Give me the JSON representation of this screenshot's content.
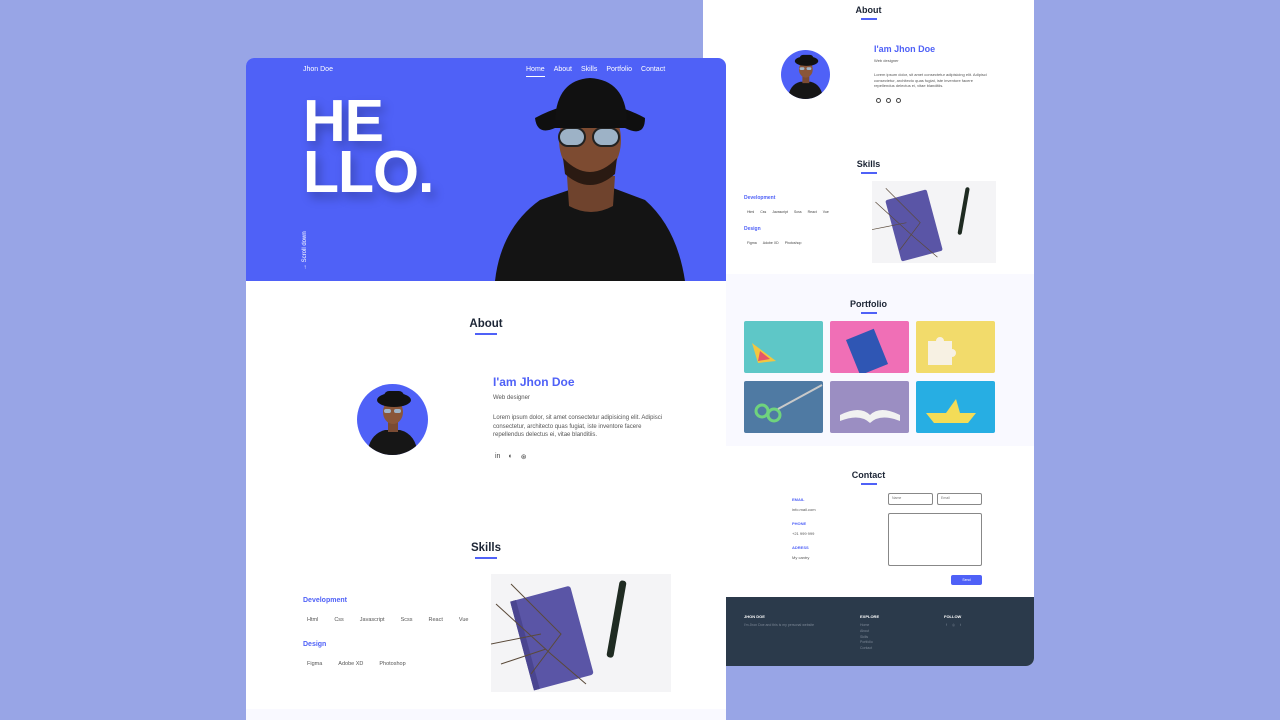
{
  "brand": "Jhon Doe",
  "nav": [
    "Home",
    "About",
    "Skills",
    "Portfolio",
    "Contact"
  ],
  "hero": {
    "line1": "HE",
    "line2": "LLO.",
    "scroll": "Scroll down"
  },
  "about": {
    "title": "About",
    "name": "I'am Jhon Doe",
    "role": "Web designer",
    "bio": "Lorem ipsum dolor, sit amet consectetur adipisicing elit. Adipisci consectetur, architecto quas fugiat, iste inventore facere repellendus delectus ei, vitae blanditiis.",
    "social_icons": [
      "linkedin-icon",
      "github-icon",
      "dribbble-icon"
    ],
    "social_glyphs": [
      "in",
      "◐",
      "⊛"
    ]
  },
  "skills": {
    "title": "Skills",
    "development": "Development",
    "dev_items": [
      "Html",
      "Css",
      "Javascript",
      "Scss",
      "React",
      "Vue"
    ],
    "design": "Design",
    "design_items": [
      "Figma",
      "Adobe XD",
      "Photoshop"
    ]
  },
  "portfolio": {
    "title": "Portfolio",
    "tile_colors": [
      "#5ec7c7",
      "#f06fb6",
      "#f2db6b",
      "#4f7aa3",
      "#9b8ec2",
      "#27aee3"
    ]
  },
  "contact": {
    "title": "Contact",
    "email_label": "EMAIL",
    "email_value": "info.mail.com",
    "phone_label": "PHONE",
    "phone_value": "+21 999 999",
    "address_label": "ADRESS",
    "address_value": "My cantry",
    "name_placeholder": "Name",
    "email_placeholder": "Email",
    "send": "Send"
  },
  "footer": {
    "brand_heading": "JHON DOE",
    "brand_text": "I'm Jhon Doe and this is my personal website",
    "explore_heading": "EXPLORE",
    "explore_links": [
      "Home",
      "About",
      "Skills",
      "Portfolio",
      "Contact"
    ],
    "follow_heading": "FOLLOW",
    "follow_icons": [
      "facebook-icon",
      "instagram-icon",
      "twitter-icon"
    ],
    "follow_glyphs": [
      "f",
      "◎",
      "t"
    ]
  },
  "colors": {
    "accent": "#4f61f7",
    "page_bg": "#98a5e6",
    "footer_bg": "#2b3a4b"
  }
}
